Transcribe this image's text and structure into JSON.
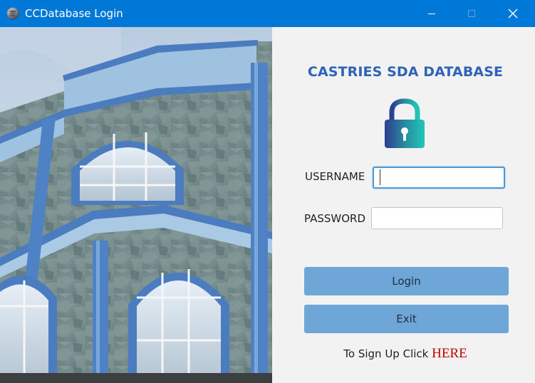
{
  "window": {
    "title": "CCDatabase Login",
    "icon": "database-globe-icon",
    "controls": [
      "minimize-icon",
      "maximize-icon",
      "close-icon"
    ]
  },
  "photo": {
    "subject": "church-building-image"
  },
  "form": {
    "title": "CASTRIES SDA DATABASE",
    "icon": "padlock-icon",
    "username_label": "USERNAME",
    "username_value": "",
    "password_label": "PASSWORD",
    "password_value": "",
    "login_label": "Login",
    "exit_label": "Exit",
    "signup_text": "To Sign Up Click ",
    "signup_link": "HERE"
  },
  "colors": {
    "titlebar": "#0078d7",
    "title_text": "#2d63b8",
    "button": "#6ea6d8",
    "link": "#c00000"
  }
}
